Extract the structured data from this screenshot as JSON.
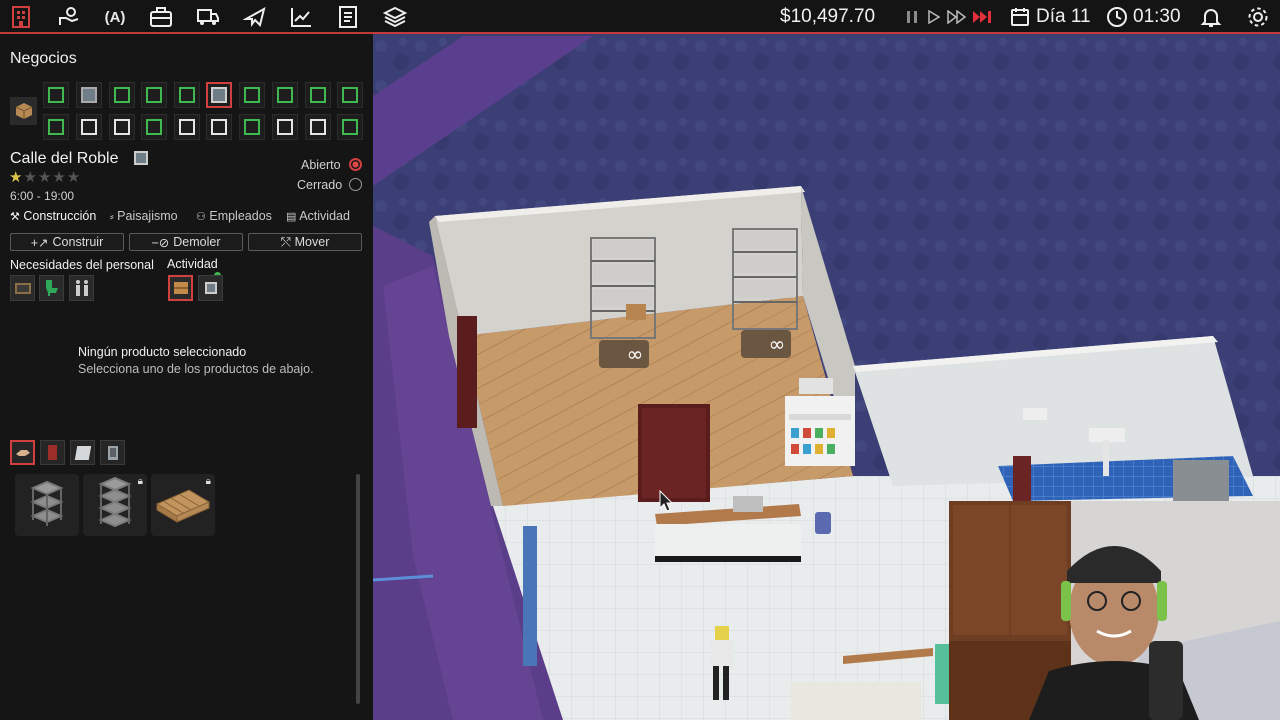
{
  "topbar": {
    "money": "$10,497.70",
    "day": "Día 11",
    "time": "01:30",
    "icons": [
      "business-icon",
      "hand-coin-icon",
      "ai-icon",
      "briefcase-icon",
      "truck-icon",
      "plane-icon",
      "chart-icon",
      "document-icon",
      "layers-icon",
      "pause-icon",
      "play-icon",
      "fast-forward-icon",
      "fastest-forward-icon",
      "calendar-icon",
      "clock-icon",
      "bell-icon",
      "gear-icon"
    ]
  },
  "sidebar": {
    "title": "Negocios",
    "business": {
      "name": "Calle del Roble",
      "rating": 1,
      "rating_max": 5,
      "hours": "6:00 - 19:00",
      "open_label": "Abierto",
      "closed_label": "Cerrado",
      "status": "open"
    },
    "tabs": [
      {
        "label": "Construcción",
        "icon": "tools-icon"
      },
      {
        "label": "Paisajismo",
        "icon": "shovel-icon"
      },
      {
        "label": "Empleados",
        "icon": "people-icon"
      },
      {
        "label": "Actividad",
        "icon": "clipboard-icon"
      }
    ],
    "actions": [
      {
        "label": "Construir",
        "icon": "plus-hammer-icon"
      },
      {
        "label": "Demoler",
        "icon": "minus-icon"
      },
      {
        "label": "Mover",
        "icon": "move-icon"
      }
    ],
    "needs_label": "Necesidades del personal",
    "activity_label": "Actividad",
    "empty_title": "Ningún producto seleccionado",
    "empty_subtitle": "Selecciona uno de los productos de abajo."
  },
  "colors": {
    "accent_red": "#d04040",
    "green": "#3fb950",
    "panel": "#151515",
    "floor": "#c89a6a"
  }
}
